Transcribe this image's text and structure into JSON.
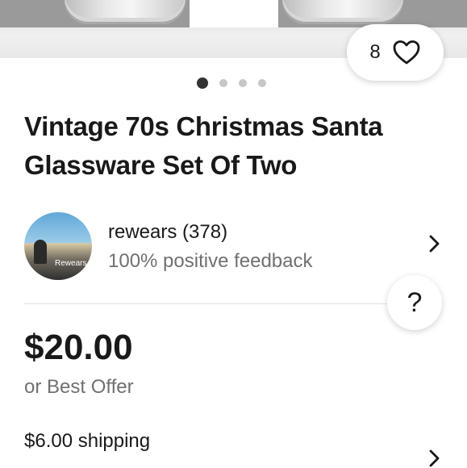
{
  "listing": {
    "watch_count": "8",
    "image_dots": 4,
    "active_dot": 0,
    "title_line1": "Vintage 70s Christmas Santa",
    "title_line2": "Glassware Set Of Two"
  },
  "seller": {
    "avatar_text": "Rewears",
    "name": "rewears (378)",
    "feedback": "100% positive feedback"
  },
  "help": {
    "label": "?"
  },
  "pricing": {
    "price": "$20.00",
    "offer": "or Best Offer",
    "shipping": "$6.00 shipping"
  },
  "icons": {
    "heart": "heart-icon",
    "chevron": "chevron-right-icon",
    "help": "question-icon"
  },
  "colors": {
    "text": "#191919",
    "secondary": "#707070",
    "divider": "#e0e0e0"
  }
}
